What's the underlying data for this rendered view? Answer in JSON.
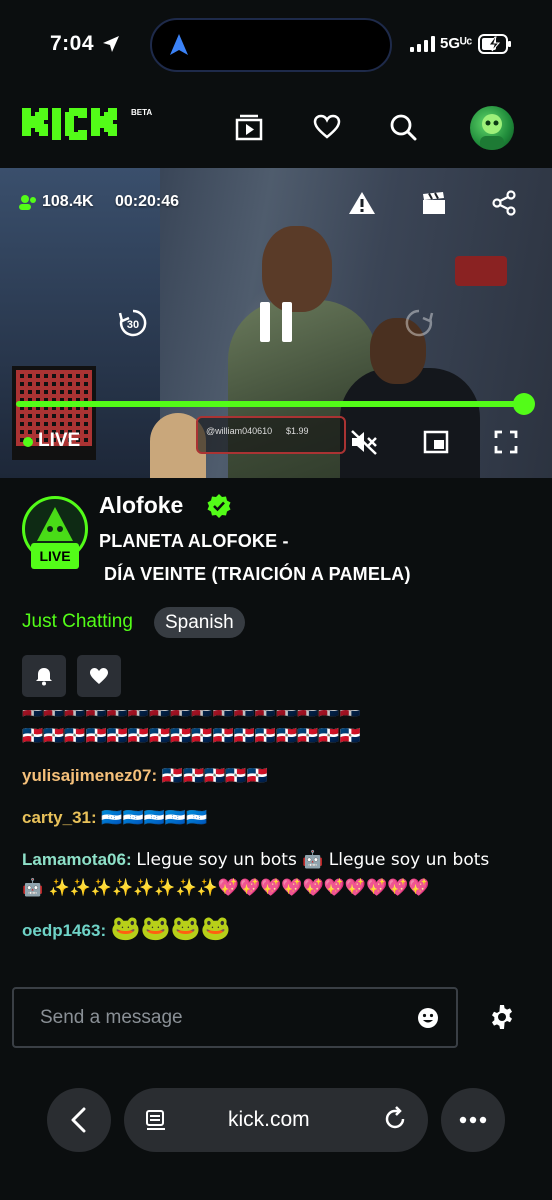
{
  "status_bar": {
    "time": "7:04",
    "network": "5Gᵁᶜ"
  },
  "header": {
    "logo_text": "KICK",
    "beta_label": "BETA"
  },
  "player": {
    "viewers": "108.4K",
    "uptime": "00:20:46",
    "live_label": "LIVE",
    "progress_percent": 100,
    "overlay_chat_user": "@william040610",
    "overlay_chat_amount": "$1.99"
  },
  "channel": {
    "name": "Alofoke",
    "live_badge": "LIVE",
    "title_line1": "PLANETA ALOFOKE -",
    "title_line2": "DÍA VEINTE (TRAICIÓN A PAMELA)",
    "category": "Just Chatting",
    "language_tag": "Spanish"
  },
  "chat": {
    "messages": [
      {
        "user": "",
        "text": "🇩🇴🇩🇴🇩🇴🇩🇴🇩🇴🇩🇴🇩🇴🇩🇴🇩🇴🇩🇴🇩🇴🇩🇴🇩🇴🇩🇴🇩🇴🇩🇴"
      },
      {
        "user": "yulisajimenez07",
        "text": "🇩🇴🇩🇴🇩🇴🇩🇴🇩🇴",
        "color": "#f5c07a"
      },
      {
        "user": "carty_31",
        "text": "🇭🇳🇭🇳🇭🇳🇭🇳🇭🇳",
        "color": "#e8c15a"
      },
      {
        "user": "Lamamota06",
        "text": "Llegue soy un bots 🤖 Llegue soy un bots",
        "text2": "🤖 ✨✨✨✨✨✨✨✨💖💖💖💖💖💖💖💖💖💖",
        "color": "#8ee0c8"
      },
      {
        "user": "oedp1463",
        "text": "🐸🐸🐸🐸",
        "color": "#6fd3c7"
      }
    ],
    "input_placeholder": "Send a message"
  },
  "browser": {
    "url": "kick.com"
  },
  "colors": {
    "brand": "#53fc18",
    "background": "#0b0e0f",
    "tag_bg": "#373c42"
  }
}
